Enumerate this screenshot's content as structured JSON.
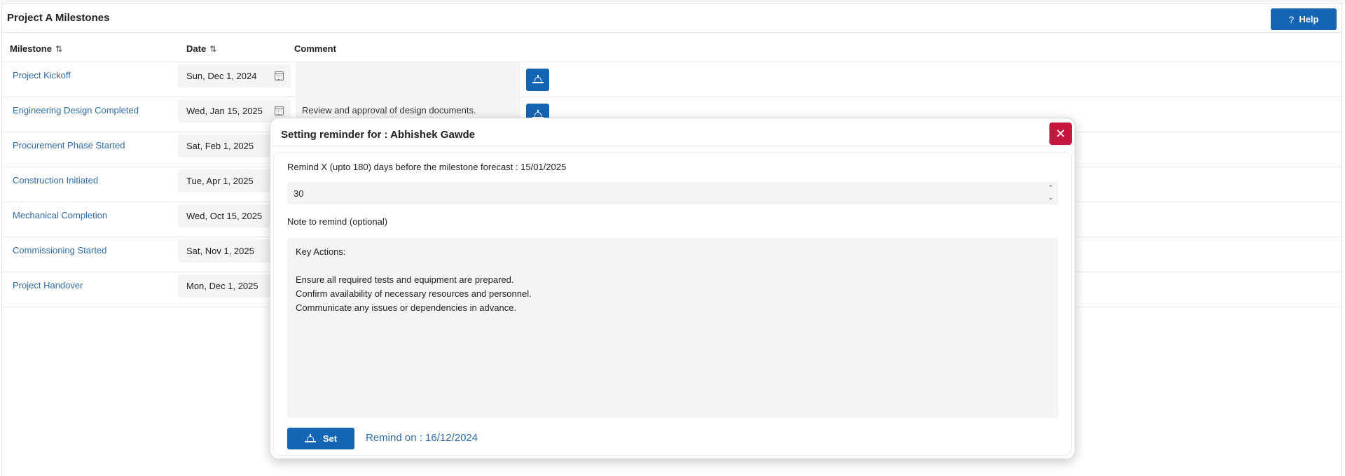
{
  "page": {
    "title": "Project A Milestones",
    "help_label": "Help",
    "help_icon": "?"
  },
  "table": {
    "columns": [
      {
        "label": "Milestone",
        "sortable": true
      },
      {
        "label": "Date",
        "sortable": true
      },
      {
        "label": "Comment",
        "sortable": false
      }
    ],
    "sort_icon": "⇅",
    "rows": [
      {
        "milestone": "Project Kickoff",
        "date": "Sun, Dec 1, 2024",
        "comment": ""
      },
      {
        "milestone": "Engineering Design Completed",
        "date": "Wed, Jan 15, 2025",
        "comment": "Review and approval of design documents."
      },
      {
        "milestone": "Procurement Phase Started",
        "date": "Sat, Feb 1, 2025",
        "comment": ""
      },
      {
        "milestone": "Construction Initiated",
        "date": "Tue, Apr 1, 2025",
        "comment": ""
      },
      {
        "milestone": "Mechanical Completion",
        "date": "Wed, Oct 15, 2025",
        "comment": ""
      },
      {
        "milestone": "Commissioning Started",
        "date": "Sat, Nov 1, 2025",
        "comment": ""
      },
      {
        "milestone": "Project Handover",
        "date": "Mon, Dec 1, 2025",
        "comment": ""
      }
    ]
  },
  "modal": {
    "title": "Setting reminder for : Abhishek Gawde",
    "close_icon": "✕",
    "remind_label": "Remind X (upto 180) days before the milestone forecast : 15/01/2025",
    "days_value": "30",
    "note_label": "Note to remind (optional)",
    "note_value": "Key Actions:\n\nEnsure all required tests and equipment are prepared.\nConfirm availability of necessary resources and personnel.\nCommunicate any issues or dependencies in advance.",
    "set_label": "Set",
    "remind_on": "Remind on : 16/12/2024"
  },
  "colors": {
    "primary": "#1565b5",
    "link": "#2f6aa0",
    "close": "#c4163e"
  },
  "icons": {
    "calendar": "calendar-icon",
    "bell": "bell-icon",
    "sort": "sort-icon",
    "help": "help-icon",
    "close": "close-icon"
  }
}
